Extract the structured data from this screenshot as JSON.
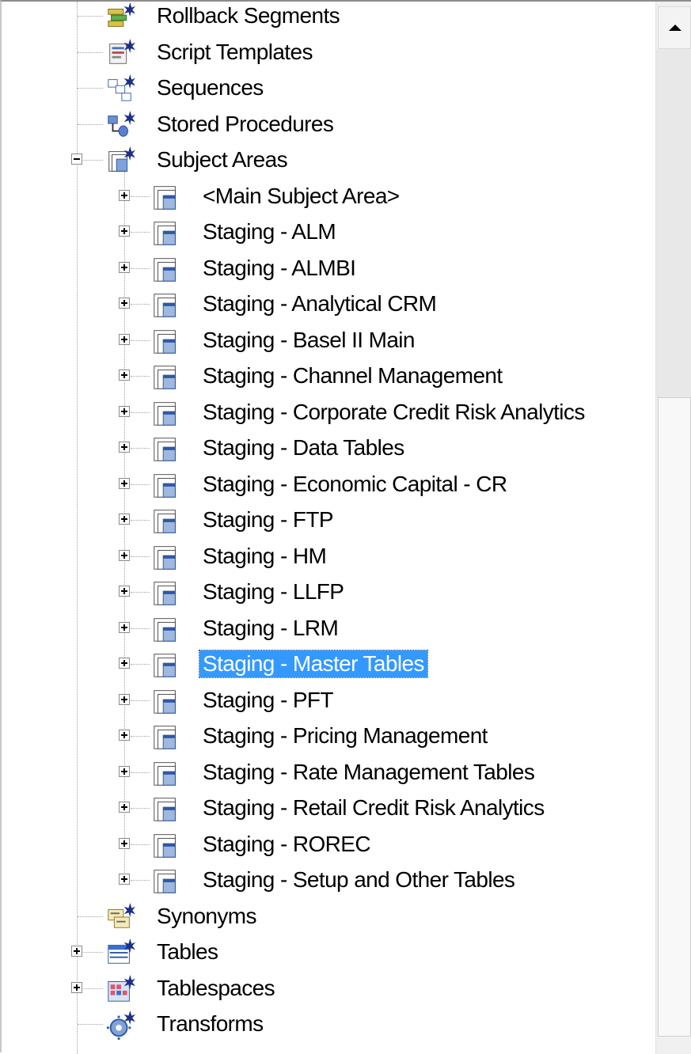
{
  "tree": {
    "top_items": [
      {
        "label": "Rollback Segments",
        "icon": "rollback-segments-icon"
      },
      {
        "label": "Script Templates",
        "icon": "script-templates-icon"
      },
      {
        "label": "Sequences",
        "icon": "sequences-icon"
      },
      {
        "label": "Stored Procedures",
        "icon": "stored-procedures-icon"
      }
    ],
    "subject_areas": {
      "label": "Subject Areas",
      "icon": "subject-areas-icon",
      "expanded": true,
      "children": [
        {
          "label": "<Main Subject Area>"
        },
        {
          "label": "Staging - ALM"
        },
        {
          "label": "Staging - ALMBI"
        },
        {
          "label": "Staging - Analytical CRM"
        },
        {
          "label": "Staging - Basel II Main"
        },
        {
          "label": "Staging - Channel Management"
        },
        {
          "label": "Staging - Corporate Credit Risk Analytics"
        },
        {
          "label": "Staging - Data Tables"
        },
        {
          "label": "Staging - Economic Capital - CR"
        },
        {
          "label": "Staging - FTP"
        },
        {
          "label": "Staging - HM"
        },
        {
          "label": "Staging - LLFP"
        },
        {
          "label": "Staging - LRM"
        },
        {
          "label": "Staging - Master Tables",
          "selected": true
        },
        {
          "label": "Staging - PFT"
        },
        {
          "label": "Staging - Pricing Management"
        },
        {
          "label": "Staging - Rate Management Tables"
        },
        {
          "label": "Staging - Retail Credit Risk Analytics"
        },
        {
          "label": "Staging - ROREC"
        },
        {
          "label": "Staging - Setup and Other Tables"
        }
      ]
    },
    "bottom_items": [
      {
        "label": "Synonyms",
        "icon": "synonyms-icon",
        "expandable": false
      },
      {
        "label": "Tables",
        "icon": "tables-icon",
        "expandable": true
      },
      {
        "label": "Tablespaces",
        "icon": "tablespaces-icon",
        "expandable": true
      },
      {
        "label": "Transforms",
        "icon": "transforms-icon",
        "expandable": false
      }
    ]
  },
  "colors": {
    "selection": "#3399ff",
    "selection_text": "#ffffff",
    "star": "#1a2f8a"
  },
  "scrollbar": {
    "up_arrow_icon": "scroll-up-arrow-icon",
    "position_fraction": 1.0
  }
}
